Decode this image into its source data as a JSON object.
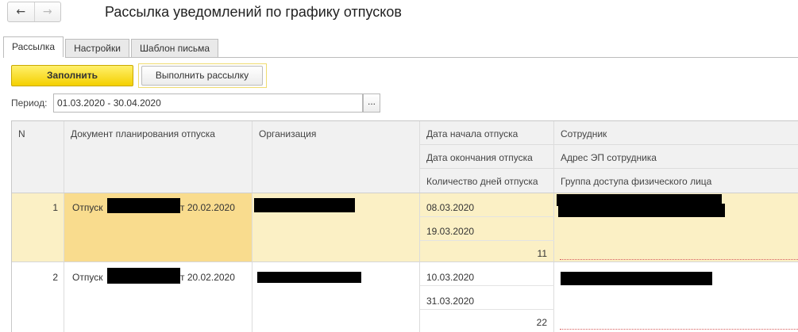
{
  "window": {
    "title": "Рассылка уведомлений по графику отпусков",
    "nav": {
      "back_icon": "←",
      "forward_icon": "→"
    }
  },
  "tabs": [
    {
      "label": "Рассылка",
      "active": true
    },
    {
      "label": "Настройки",
      "active": false
    },
    {
      "label": "Шаблон письма",
      "active": false
    }
  ],
  "toolbar": {
    "fill_label": "Заполнить",
    "send_label": "Выполнить рассылку"
  },
  "period": {
    "label": "Период:",
    "value": "01.03.2020 - 30.04.2020",
    "select_icon": "..."
  },
  "table": {
    "headers": {
      "n": "N",
      "document": "Документ планирования отпуска",
      "organization": "Организация",
      "start_date": "Дата начала отпуска",
      "end_date": "Дата окончания отпуска",
      "days": "Количество дней отпуска",
      "employee": "Сотрудник",
      "email": "Адрес ЭП сотрудника",
      "access_group": "Группа доступа физического лица"
    },
    "rows": [
      {
        "n": "1",
        "document_prefix": "Отпуск",
        "document_suffix": "т 20.02.2020",
        "start_date": "08.03.2020",
        "end_date": "19.03.2020",
        "days": "11"
      },
      {
        "n": "2",
        "document_prefix": "Отпуск",
        "document_suffix": "т 20.02.2020",
        "start_date": "10.03.2020",
        "end_date": "31.03.2020",
        "days": "22"
      }
    ]
  },
  "colors": {
    "accent_yellow": "#f4d000",
    "selected_row": "#fbf0c5",
    "active_cell": "#f9dc8e",
    "header_bg": "#f1f1f1"
  }
}
